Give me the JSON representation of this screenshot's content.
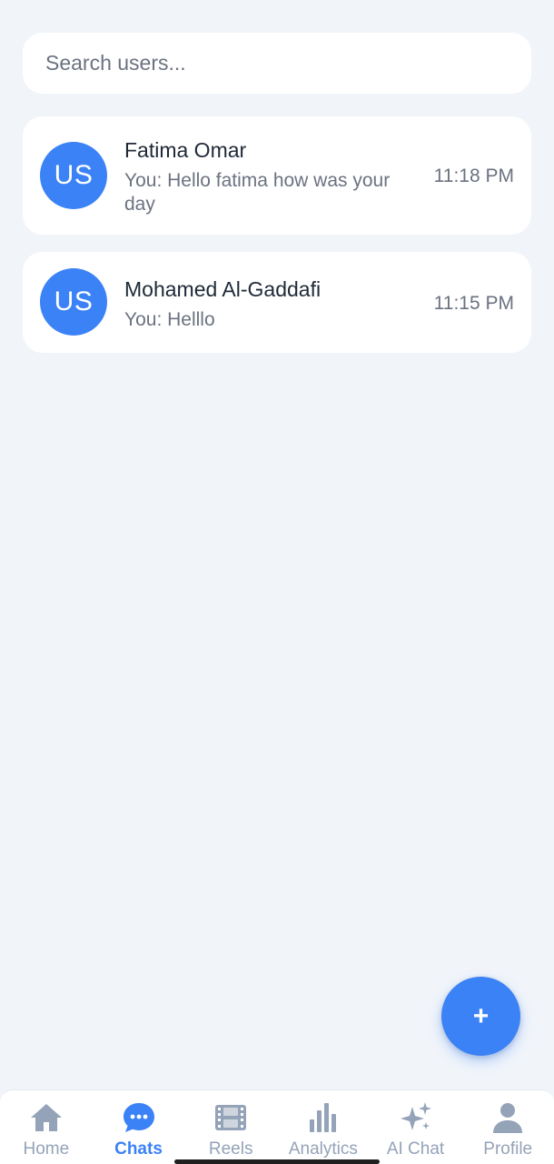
{
  "search": {
    "placeholder": "Search users..."
  },
  "chats": [
    {
      "avatar_initials": "US",
      "name": "Fatima Omar",
      "preview": "You: Hello fatima how was your day",
      "time": "11:18 PM"
    },
    {
      "avatar_initials": "US",
      "name": "Mohamed Al-Gaddafi",
      "preview": "You: Helllo",
      "time": "11:15 PM"
    }
  ],
  "fab": {
    "label": "+"
  },
  "nav": {
    "items": [
      {
        "label": "Home",
        "icon": "home-icon"
      },
      {
        "label": "Chats",
        "icon": "chat-bubble-icon",
        "active": true
      },
      {
        "label": "Reels",
        "icon": "film-icon"
      },
      {
        "label": "Analytics",
        "icon": "bar-chart-icon"
      },
      {
        "label": "AI Chat",
        "icon": "sparkles-icon"
      },
      {
        "label": "Profile",
        "icon": "user-icon"
      }
    ]
  },
  "colors": {
    "accent": "#3b82f6",
    "inactive": "#94a3b8",
    "background": "#f1f5fa"
  }
}
